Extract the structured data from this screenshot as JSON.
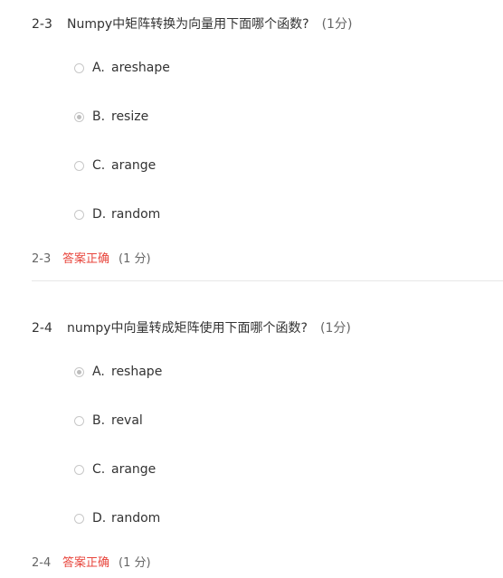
{
  "questions": [
    {
      "number": "2-3",
      "text": "Numpy中矩阵转换为向量用下面哪个函数?",
      "score": "(1分)",
      "options": [
        {
          "letter": "A.",
          "text": "areshape",
          "selected": false
        },
        {
          "letter": "B.",
          "text": "resize",
          "selected": true
        },
        {
          "letter": "C.",
          "text": "arange",
          "selected": false
        },
        {
          "letter": "D.",
          "text": "random",
          "selected": false
        }
      ],
      "result": {
        "number": "2-3",
        "status": "答案正确",
        "score": "(1 分)"
      }
    },
    {
      "number": "2-4",
      "text": "numpy中向量转成矩阵使用下面哪个函数?",
      "score": "(1分)",
      "options": [
        {
          "letter": "A.",
          "text": "reshape",
          "selected": true
        },
        {
          "letter": "B.",
          "text": "reval",
          "selected": false
        },
        {
          "letter": "C.",
          "text": "arange",
          "selected": false
        },
        {
          "letter": "D.",
          "text": "random",
          "selected": false
        }
      ],
      "result": {
        "number": "2-4",
        "status": "答案正确",
        "score": "(1 分)"
      }
    }
  ],
  "colors": {
    "status_correct": "#e8453c",
    "text": "#333333",
    "muted": "#666666",
    "divider": "#e8e8e8"
  }
}
